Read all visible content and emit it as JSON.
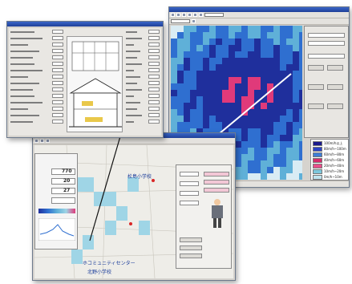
{
  "front_window": {
    "title": "",
    "value_label_1": "770",
    "value_label_2": "20",
    "value_label_3": "27",
    "value_label_4": "",
    "school_label_top": "松島小学校",
    "center_label": "ホコミュニティセンター",
    "school_label_bottom": "北野小学校"
  },
  "right_window": {
    "status_text": "",
    "legend_entries": [
      "100m/h以上",
      "80m/h~100m",
      "60m/h~80m",
      "40m/h~60m",
      "20m/h~40m",
      "10m/h~20m",
      "0m/h~10m"
    ],
    "legend_colors": [
      "#1a1a8c",
      "#2b44c6",
      "#3e7fd6",
      "#d62a6b",
      "#e84f8a",
      "#7dc7dc",
      "#bfe4ef"
    ]
  },
  "colors": {
    "window_bg": "#d6d3ce",
    "titlebar": "#2a4fb0",
    "map_base": "#cde5f0",
    "rain_high": "#1f2f9c",
    "rain_mid": "#2f6fd0",
    "rain_low": "#5fb0d8",
    "rain_pink": "#e03a7a"
  }
}
